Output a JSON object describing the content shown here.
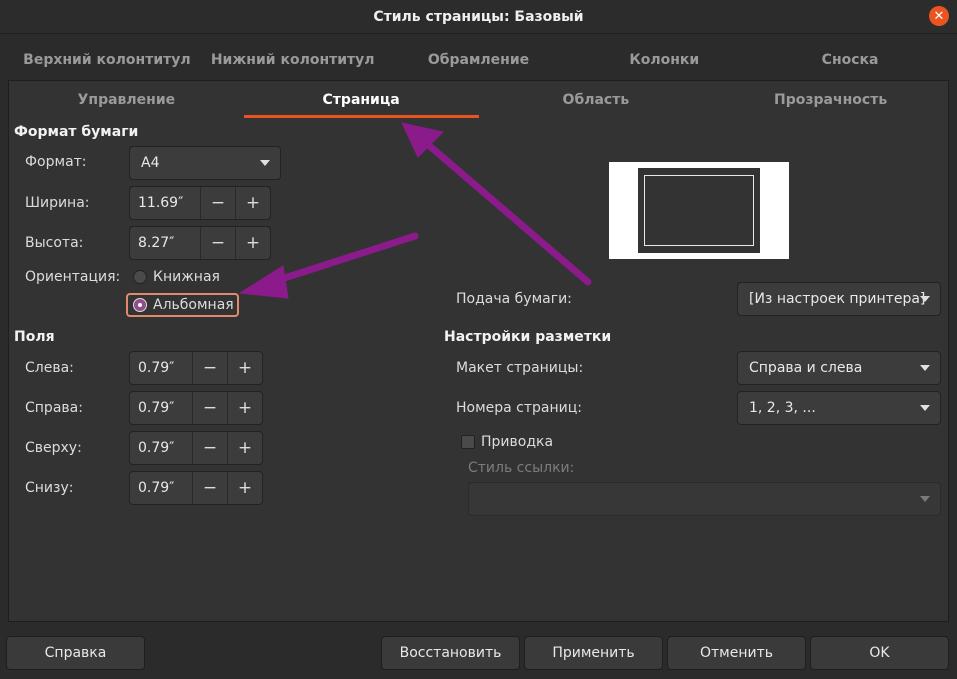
{
  "window": {
    "title": "Стиль страницы: Базовый"
  },
  "tabs_top": [
    "Верхний колонтитул",
    "Нижний колонтитул",
    "Обрамление",
    "Колонки",
    "Сноска"
  ],
  "tabs_bottom": [
    "Управление",
    "Страница",
    "Область",
    "Прозрачность"
  ],
  "active_tab": "Страница",
  "paper_format": {
    "heading": "Формат бумаги",
    "format_label": "Формат:",
    "format_value": "A4",
    "width_label": "Ширина:",
    "width_value": "11.69″",
    "height_label": "Высота:",
    "height_value": "8.27″",
    "orientation_label": "Ориентация:",
    "portrait_label": "Книжная",
    "landscape_label": "Альбомная",
    "selected": "Альбомная"
  },
  "margins": {
    "heading": "Поля",
    "left_label": "Слева:",
    "left_value": "0.79″",
    "right_label": "Справа:",
    "right_value": "0.79″",
    "top_label": "Сверху:",
    "top_value": "0.79″",
    "bottom_label": "Снизу:",
    "bottom_value": "0.79″"
  },
  "paper_tray": {
    "label": "Подача бумаги:",
    "value": "[Из настроек принтера]"
  },
  "layout": {
    "heading": "Настройки разметки",
    "page_layout_label": "Макет страницы:",
    "page_layout_value": "Справа и слева",
    "numbering_label": "Номера страниц:",
    "numbering_value": "1, 2, 3, ...",
    "register_label": "Приводка",
    "register_checked": false,
    "ref_style_label": "Стиль ссылки:",
    "ref_style_value": ""
  },
  "spin": {
    "minus": "−",
    "plus": "+"
  },
  "buttons": {
    "help": "Справка",
    "reset": "Восстановить",
    "apply": "Применить",
    "cancel": "Отменить",
    "ok": "OK"
  },
  "colors": {
    "accent": "#e95420",
    "annotation_arrow": "#8b1a8b",
    "radio_selected": "#924d8b"
  }
}
